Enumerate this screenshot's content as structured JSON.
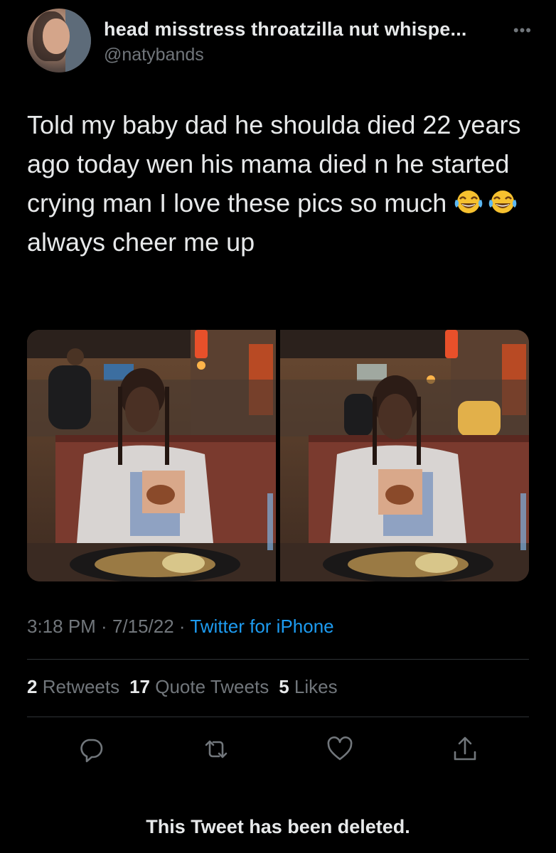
{
  "author": {
    "display_name": "head misstress throatzilla nut whispe...",
    "handle": "@natybands"
  },
  "more_icon": "more-horizontal-icon",
  "tweet": {
    "text_part1": "Told my baby dad he shoulda died 22 years ago today wen his mama died n he started crying man I love these pics so much ",
    "text_part2": "always cheer me up",
    "emojis": [
      "face-with-tears-of-joy",
      "face-with-tears-of-joy"
    ]
  },
  "media": {
    "count": 2
  },
  "meta": {
    "time": "3:18 PM",
    "separator1": " · ",
    "date": "7/15/22",
    "separator2": " · ",
    "source": "Twitter for iPhone"
  },
  "stats": {
    "retweets_count": "2",
    "retweets_label": "Retweets",
    "quotes_count": "17",
    "quotes_label": "Quote Tweets",
    "likes_count": "5",
    "likes_label": "Likes"
  },
  "actions": [
    "reply-icon",
    "retweet-icon",
    "like-icon",
    "share-icon"
  ],
  "notice": {
    "deleted_text": "This Tweet has been deleted."
  },
  "colors": {
    "background": "#000000",
    "text": "#e7e9ea",
    "secondary": "#71767b",
    "link": "#1d9bf0",
    "divider": "#2f3336"
  }
}
